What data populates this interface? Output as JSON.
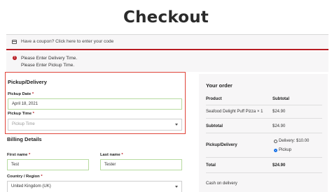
{
  "page_title": "Checkout",
  "coupon": {
    "text": "Have a coupon? Click here to enter your code"
  },
  "errors": [
    "Please Enter Delivery Time.",
    "Please Enter Pickup Time."
  ],
  "pickup_delivery": {
    "heading": "Pickup/Delivery",
    "date_label": "Pickup Date",
    "date_value": "April 18, 2021",
    "time_label": "Pickup Time",
    "time_placeholder": "Pickup Time",
    "required_mark": "*"
  },
  "billing": {
    "heading": "Billing Details",
    "first_name_label": "First name",
    "first_name_value": "Test",
    "last_name_label": "Last name",
    "last_name_value": "Tester",
    "country_label": "Country / Region",
    "country_value": "United Kingdom (UK)",
    "required_mark": "*"
  },
  "order": {
    "heading": "Your order",
    "col_product": "Product",
    "col_subtotal": "Subtotal",
    "item_name": "Seafood Delight Puff Pizza",
    "item_qty": "× 1",
    "item_subtotal": "$24.90",
    "subtotal_label": "Subtotal",
    "subtotal_value": "$24.90",
    "pickup_delivery_label": "Pickup/Delivery",
    "delivery_option": "Delivery: $10.00",
    "pickup_option": "Pickup",
    "selected_option": "Pickup",
    "total_label": "Total",
    "total_value": "$24.90",
    "payment_label": "Cash on delivery"
  },
  "colors": {
    "error_red": "#b81c23",
    "valid_green": "#b7dba0",
    "panel_bg": "#f7f6f7",
    "radio_blue": "#1a73e8"
  }
}
